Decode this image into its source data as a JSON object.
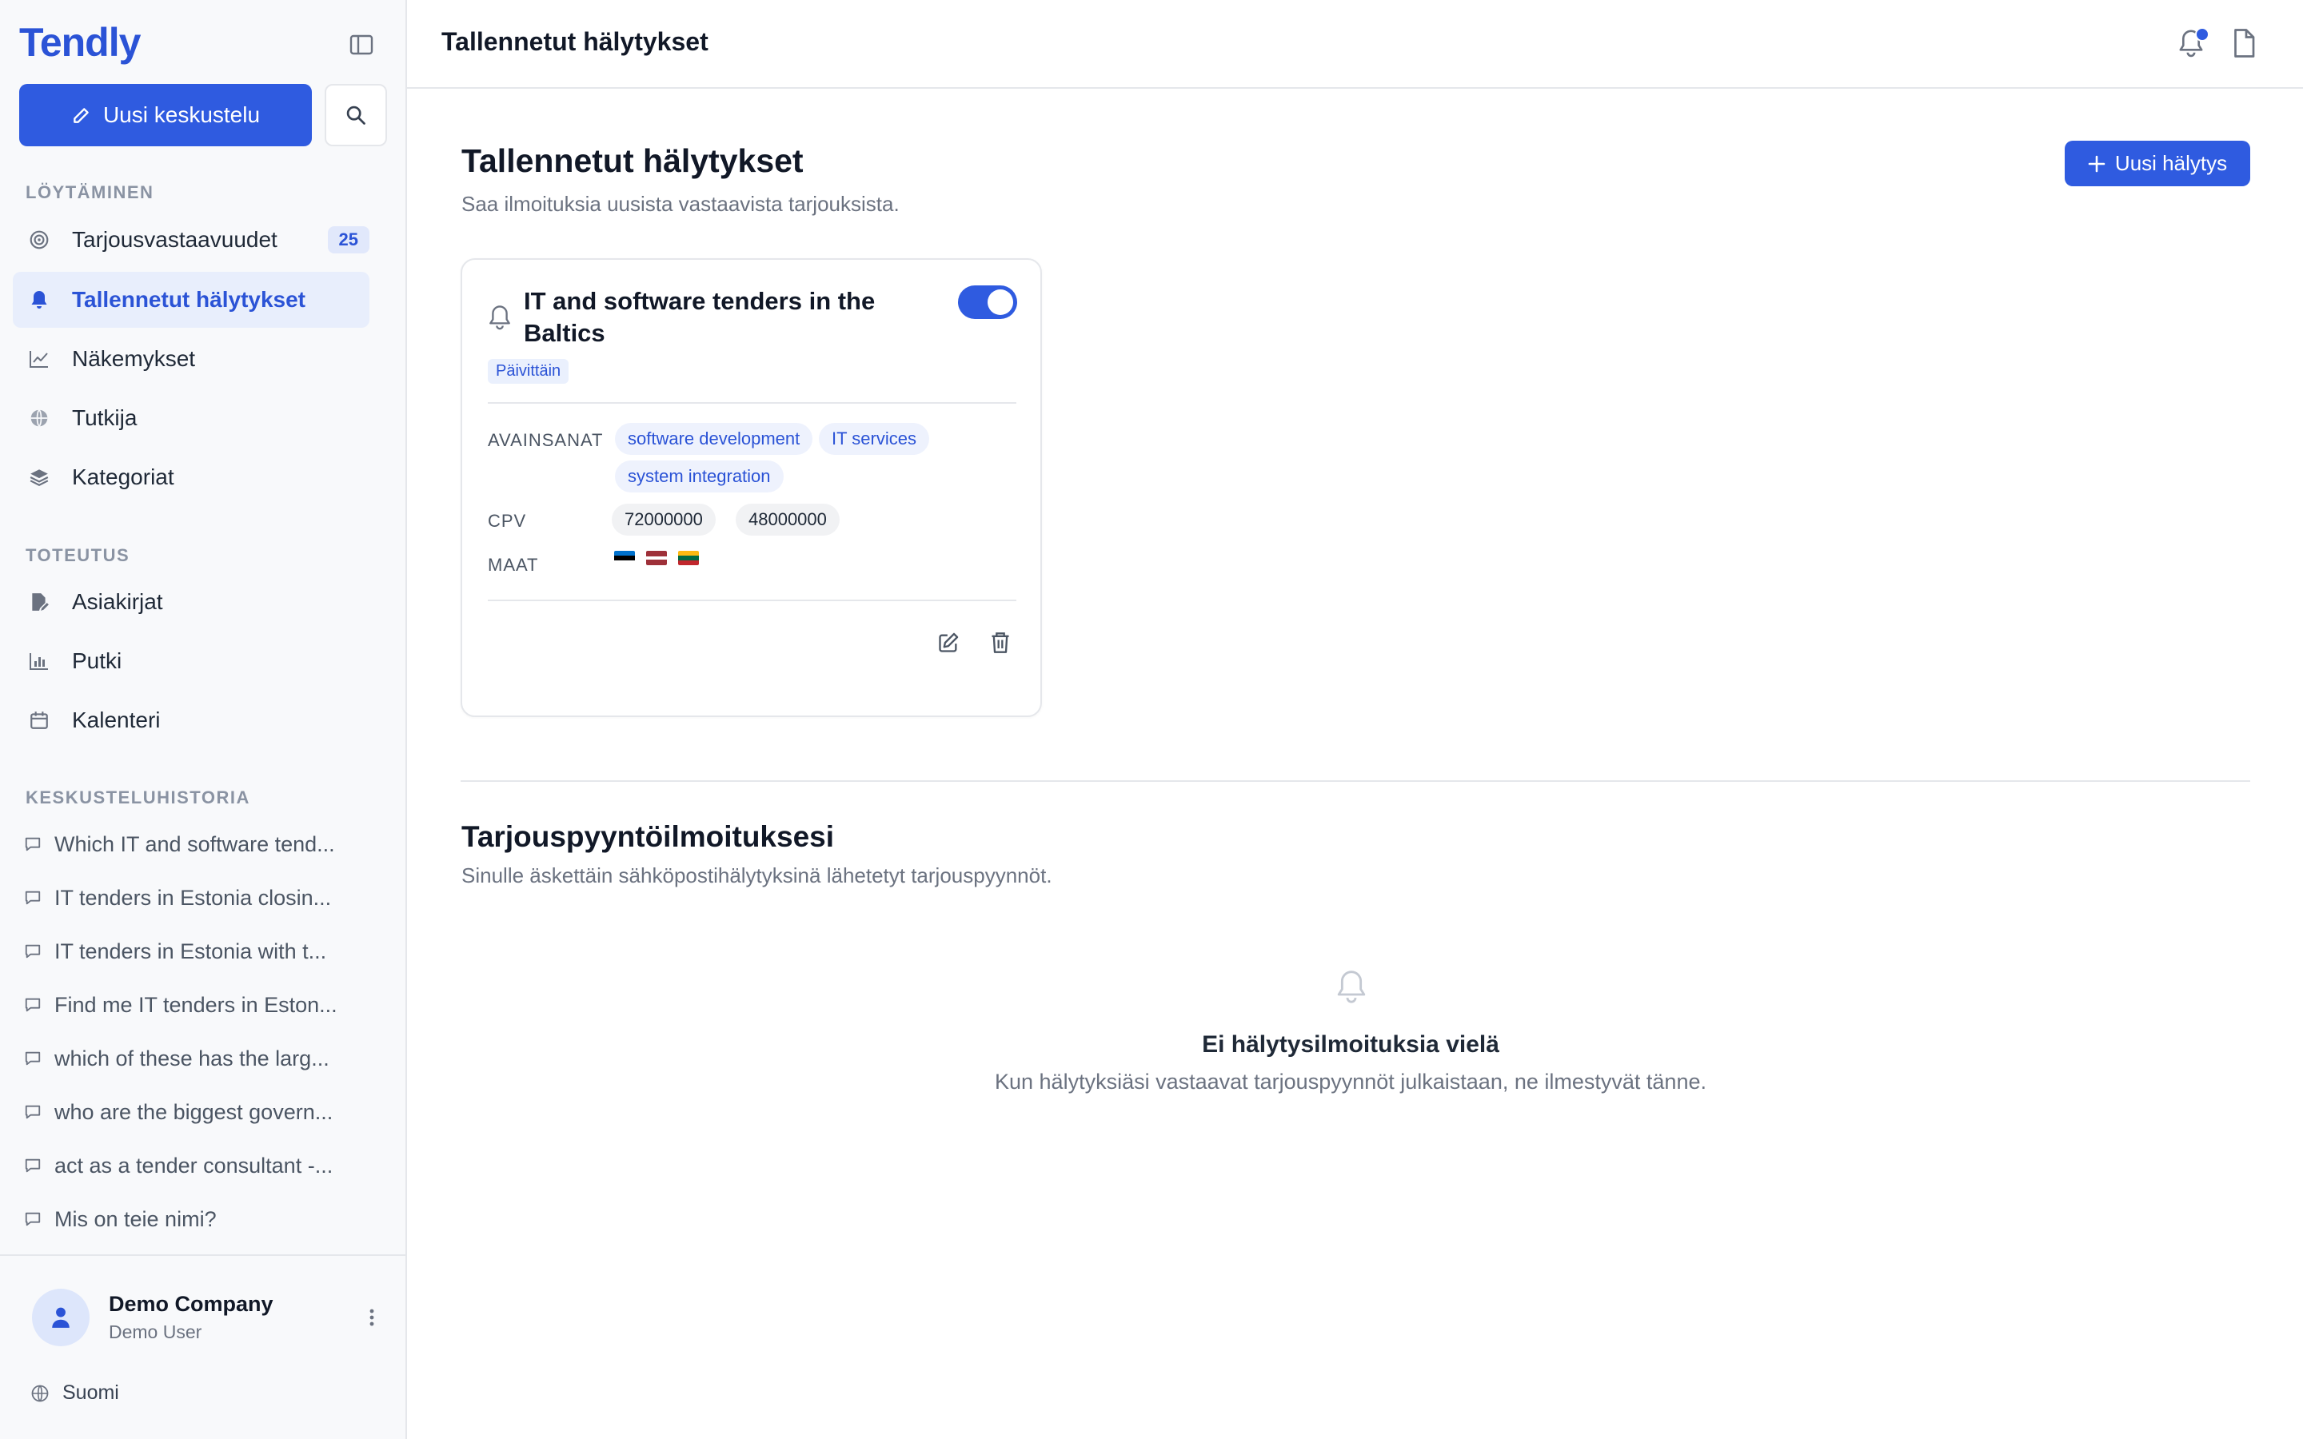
{
  "app": {
    "logo": "Tendly"
  },
  "sidebar": {
    "new_chat_label": "Uusi keskustelu",
    "sections": {
      "discovery": "LÖYTÄMINEN",
      "execution": "TOTEUTUS",
      "history": "KESKUSTELUHISTORIA"
    },
    "discovery_items": [
      {
        "label": "Tarjousvastaavuudet",
        "icon": "target-icon",
        "badge": "25"
      },
      {
        "label": "Tallennetut hälytykset",
        "icon": "bell-icon",
        "active": true
      },
      {
        "label": "Näkemykset",
        "icon": "line-chart-icon"
      },
      {
        "label": "Tutkija",
        "icon": "globe-icon"
      },
      {
        "label": "Kategoriat",
        "icon": "layers-icon"
      }
    ],
    "execution_items": [
      {
        "label": "Asiakirjat",
        "icon": "document-edit-icon"
      },
      {
        "label": "Putki",
        "icon": "bar-chart-icon"
      },
      {
        "label": "Kalenteri",
        "icon": "calendar-icon"
      }
    ],
    "history_items": [
      "Which IT and software tend...",
      "IT tenders in Estonia closin...",
      "IT tenders in Estonia with t...",
      "Find me IT tenders in Eston...",
      "which of these has the larg...",
      "who are the biggest govern...",
      "act as a tender consultant -...",
      "Mis on teie nimi?"
    ],
    "user": {
      "company": "Demo Company",
      "name": "Demo User"
    },
    "language": "Suomi"
  },
  "topbar": {
    "title": "Tallennetut hälytykset",
    "notification_dot": true
  },
  "page": {
    "title": "Tallennetut hälytykset",
    "subtitle": "Saa ilmoituksia uusista vastaavista tarjouksista.",
    "new_alert_label": "Uusi hälytys"
  },
  "alert_card": {
    "title": "IT and software tenders in the Baltics",
    "enabled": true,
    "frequency": "Päivittäin",
    "keywords_label": "AVAINSANAT",
    "keywords": [
      "software development",
      "IT services",
      "system integration"
    ],
    "cpv_label": "CPV",
    "cpv_codes": [
      "72000000",
      "48000000"
    ],
    "countries_label": "MAAT",
    "countries": [
      "Estonia",
      "Latvia",
      "Lithuania"
    ]
  },
  "notifications_section": {
    "title": "Tarjouspyyntöilmoituksesi",
    "subtitle": "Sinulle äskettäin sähköpostihälytyksinä lähetetyt tarjouspyynnöt.",
    "empty_title": "Ei hälytysilmoituksia vielä",
    "empty_subtitle": "Kun hälytyksiäsi vastaavat tarjouspyynnöt julkaistaan, ne ilmestyvät tänne."
  },
  "colors": {
    "accent": "#2f5be0",
    "sidebar_bg": "#f8f9fb",
    "active_bg": "#e8eefc"
  }
}
